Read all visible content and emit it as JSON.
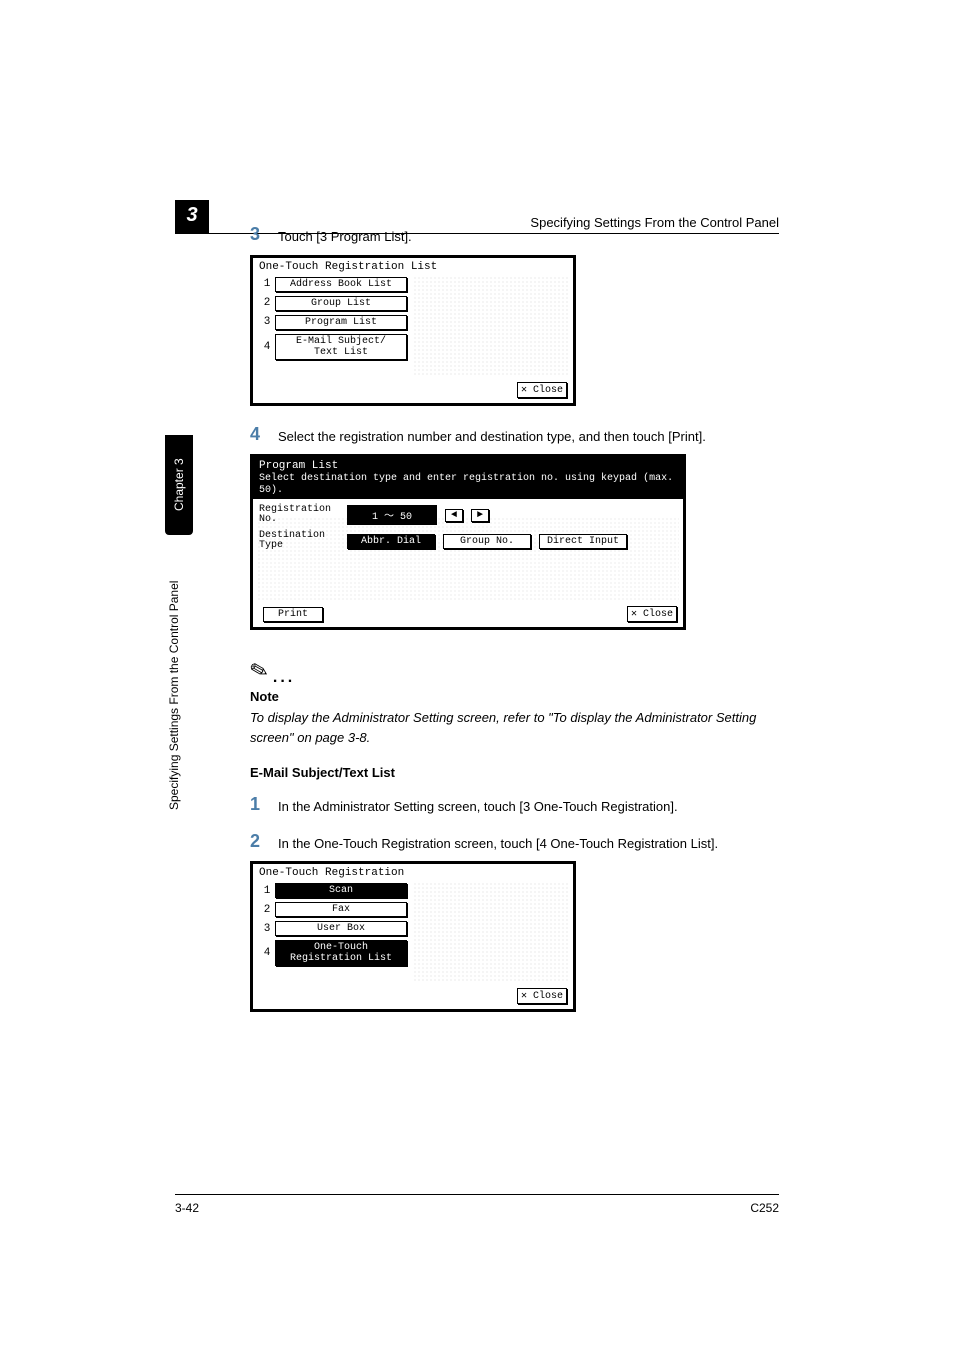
{
  "header": {
    "running": "Specifying Settings From the Control Panel",
    "chapter_badge": "3"
  },
  "sidebar": {
    "tab": "Chapter 3",
    "text": "Specifying Settings From the Control Panel"
  },
  "step3": {
    "num": "3",
    "text": "Touch [3 Program List]."
  },
  "shot1": {
    "title": "One-Touch Registration List",
    "items": [
      {
        "n": "1",
        "label": "Address Book List"
      },
      {
        "n": "2",
        "label": "Group List"
      },
      {
        "n": "3",
        "label": "Program List"
      },
      {
        "n": "4",
        "label": "E-Mail Subject/\nText List"
      }
    ],
    "close": "Close"
  },
  "step4": {
    "num": "4",
    "text": "Select the registration number and destination type, and then touch [Print]."
  },
  "shot2": {
    "title": "Program List",
    "subtitle": "Select destination type and enter registration no. using keypad (max. 50).",
    "reg_label": "Registration\nNo.",
    "reg_range": "1  ～  50",
    "arrow_left": "◄",
    "arrow_right": "►",
    "dest_label": "Destination\nType",
    "opts": [
      "Abbr. Dial",
      "Group No.",
      "Direct Input"
    ],
    "print": "Print",
    "close": "Close"
  },
  "note": {
    "icon": "✎",
    "dots": "...",
    "label": "Note",
    "text": "To display the Administrator Setting screen, refer to \"To display the Administrator Setting screen\" on page 3-8."
  },
  "section": {
    "head": "E-Mail Subject/Text List"
  },
  "step1b": {
    "num": "1",
    "text": "In the Administrator Setting screen, touch [3 One-Touch Registration]."
  },
  "step2b": {
    "num": "2",
    "text": "In the One-Touch Registration screen, touch [4 One-Touch Registration List]."
  },
  "shot3": {
    "title": "One-Touch Registration",
    "items": [
      {
        "n": "1",
        "label": "Scan"
      },
      {
        "n": "2",
        "label": "Fax"
      },
      {
        "n": "3",
        "label": "User Box"
      },
      {
        "n": "4",
        "label": "One-Touch\nRegistration List"
      }
    ],
    "close": "Close"
  },
  "footer": {
    "left": "3-42",
    "right": "C252"
  }
}
